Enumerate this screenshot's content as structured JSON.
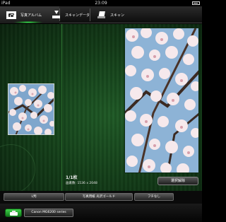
{
  "status_bar": {
    "carrier": "iPad",
    "time": "23:09"
  },
  "tabs": [
    {
      "label": "写真アルバム",
      "icon": "photo-album-icon",
      "selected": true
    },
    {
      "label": "スキャンデータ",
      "icon": "scan-tray-icon",
      "selected": false
    },
    {
      "label": "スキャン",
      "icon": "scanner-icon",
      "selected": false
    }
  ],
  "photo": {
    "count_text": "1/1枚",
    "pixel_info": "画素数: 1536 x 2048",
    "deselect_label": "選択解除"
  },
  "print_settings": {
    "paper_size": "L判",
    "media_type": "写真用紙 光沢ゴールド",
    "border": "フチなし"
  },
  "printer": {
    "name": "Canon MG6200 series"
  },
  "colors": {
    "accent_green": "#3dff5e",
    "background_green": "#123a17"
  }
}
